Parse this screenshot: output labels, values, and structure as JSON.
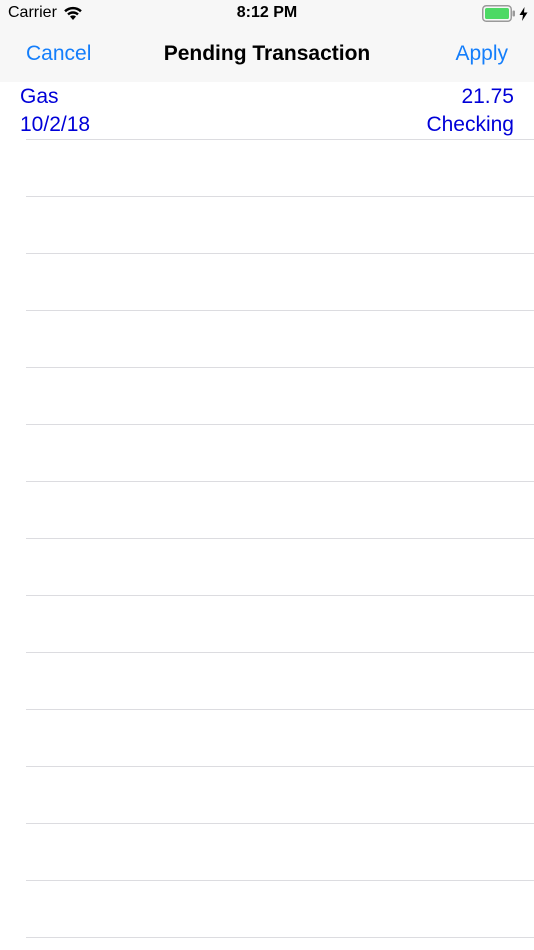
{
  "status_bar": {
    "carrier": "Carrier",
    "time": "8:12 PM",
    "wifi_icon": "wifi-icon",
    "battery_icon": "battery-icon",
    "charging_icon": "bolt-icon"
  },
  "nav": {
    "cancel_label": "Cancel",
    "title": "Pending Transaction",
    "apply_label": "Apply"
  },
  "transaction": {
    "payee": "Gas",
    "amount": "21.75",
    "date": "10/2/18",
    "account": "Checking"
  },
  "colors": {
    "accent": "#147efb",
    "transaction_text": "#0000d8",
    "battery": "#4cd964"
  }
}
